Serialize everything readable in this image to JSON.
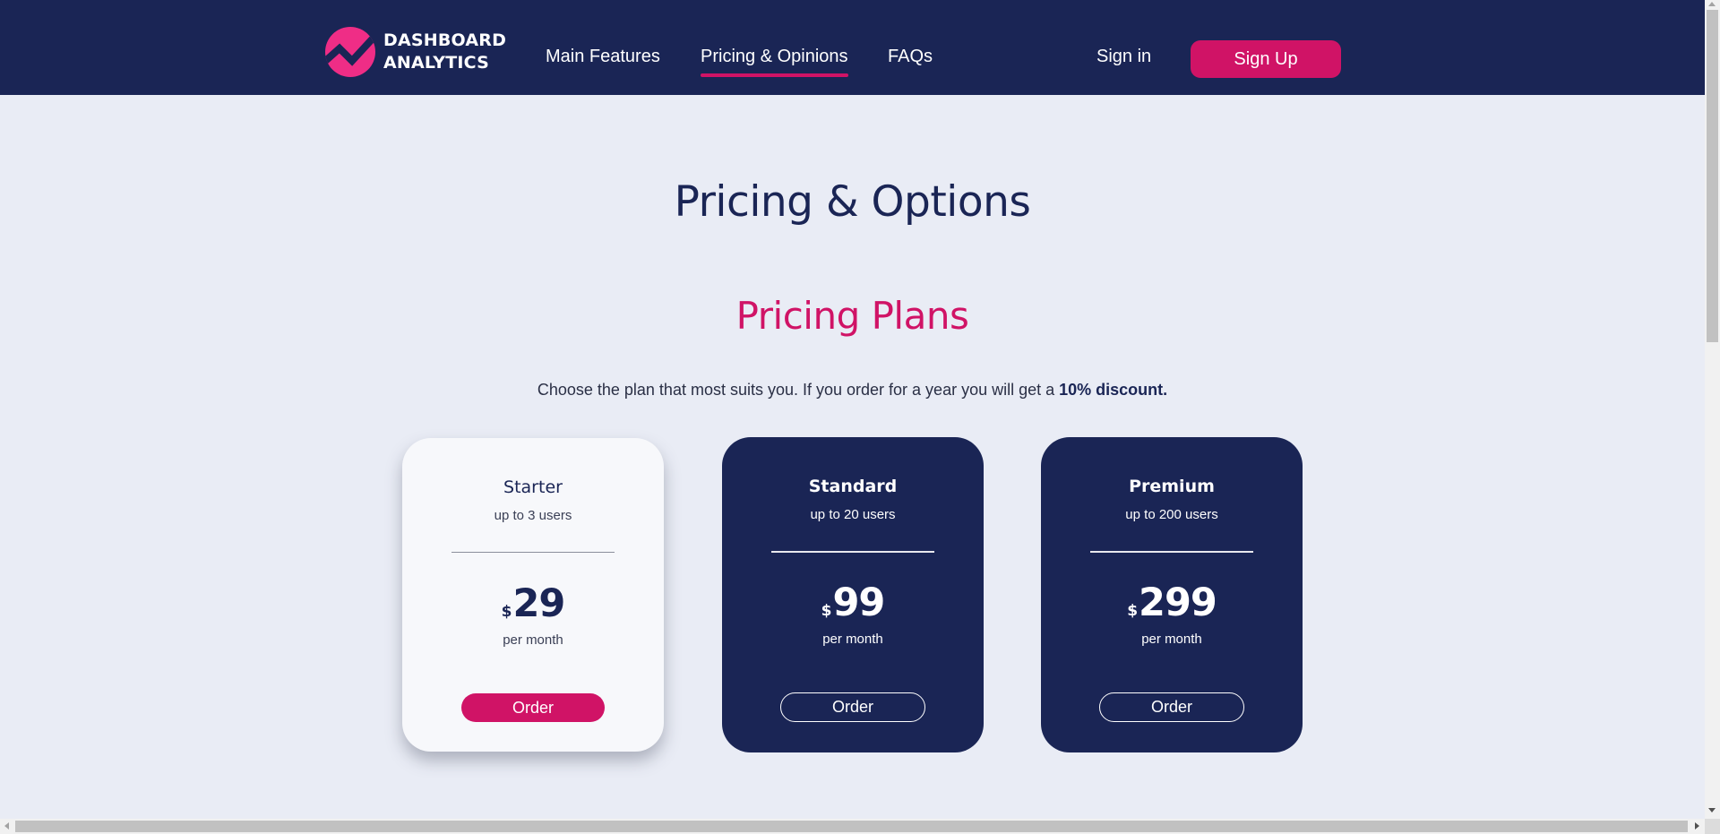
{
  "brand": {
    "line1": "DASHBOARD",
    "line2": "ANALYTICS",
    "logo_icon": "trend-chart-circle-icon"
  },
  "nav": {
    "items": [
      {
        "label": "Main Features",
        "active": false
      },
      {
        "label": "Pricing & Opinions",
        "active": true
      },
      {
        "label": "FAQs",
        "active": false
      }
    ],
    "sign_in": "Sign in",
    "sign_up": "Sign Up"
  },
  "page": {
    "title": "Pricing & Options",
    "section_title": "Pricing Plans",
    "intro_text": "Choose the plan that most suits you. If you order for a year you will get a ",
    "intro_highlight": "10% discount."
  },
  "plans": [
    {
      "name": "Starter",
      "users": "up to 3 users",
      "currency": "$",
      "price": "29",
      "period": "per month",
      "button": "Order",
      "highlighted": true
    },
    {
      "name": "Standard",
      "users": "up to 20 users",
      "currency": "$",
      "price": "99",
      "period": "per month",
      "button": "Order",
      "highlighted": false
    },
    {
      "name": "Premium",
      "users": "up to 200 users",
      "currency": "$",
      "price": "299",
      "period": "per month",
      "button": "Order",
      "highlighted": false
    }
  ],
  "colors": {
    "navy": "#1a2555",
    "accent": "#d01366",
    "logo_pink": "#ef2d86",
    "background": "#e9ecf5",
    "card_light": "#f7f8fb"
  }
}
